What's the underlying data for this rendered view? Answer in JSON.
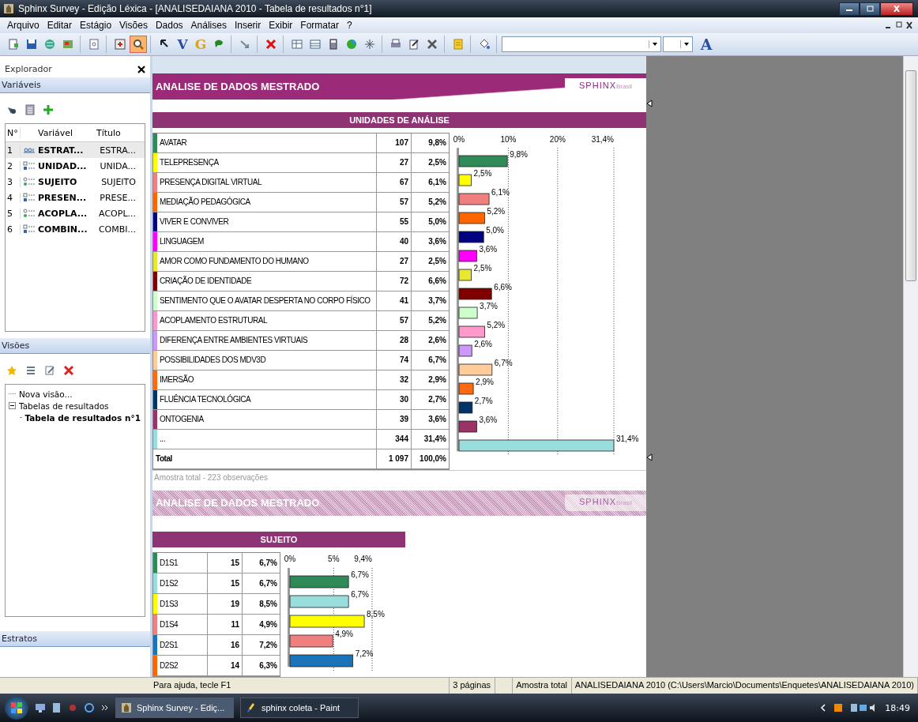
{
  "window": {
    "title": "Sphinx Survey - Edição Léxica - [ANALISEDAIANA 2010 - Tabela de resultados n°1]"
  },
  "menu": [
    {
      "label": "Arquivo"
    },
    {
      "label": "Editar"
    },
    {
      "label": "Estágio"
    },
    {
      "label": "Visões"
    },
    {
      "label": "Dados"
    },
    {
      "label": "Análises"
    },
    {
      "label": "Inserir"
    },
    {
      "label": "Exibir"
    },
    {
      "label": "Formatar"
    },
    {
      "label": "?"
    }
  ],
  "toolbar": {
    "groups": [
      [
        {
          "active": false
        },
        {
          "active": false
        },
        {
          "active": false
        },
        {
          "active": false
        }
      ],
      [
        {
          "active": false
        }
      ],
      [
        {
          "active": false
        },
        {
          "active": true
        }
      ],
      [
        {
          "active": false
        },
        {
          "glyph": "V",
          "active": false
        },
        {
          "glyph": "G",
          "active": false
        },
        {
          "active": false
        }
      ],
      [
        {
          "active": false
        }
      ],
      [
        {
          "active": false
        }
      ],
      [
        {
          "active": false
        },
        {
          "active": false
        },
        {
          "active": false
        },
        {
          "active": false
        },
        {
          "active": false
        }
      ],
      [
        {
          "active": false
        },
        {
          "active": false
        },
        {
          "active": false
        }
      ],
      [
        {
          "active": false
        }
      ],
      [
        {
          "active": false
        }
      ]
    ],
    "end_glyph": "A"
  },
  "explorer": {
    "title": "Explorador",
    "variables": {
      "title": "Variáveis",
      "columns": [
        "N°",
        "Variável",
        "Título"
      ],
      "rows": [
        {
          "number": "1",
          "kind": "text",
          "name": "ESTRAT...",
          "title": "ESTRA...",
          "selected": true
        },
        {
          "number": "2",
          "kind": "closed",
          "name": "UNIDAD...",
          "title": "UNIDA...",
          "selected": false
        },
        {
          "number": "3",
          "kind": "scale",
          "name": "SUJEITO",
          "title": "SUJEITO",
          "selected": false
        },
        {
          "number": "4",
          "kind": "closed",
          "name": "PRESEN...",
          "title": "PRESE...",
          "selected": false
        },
        {
          "number": "5",
          "kind": "scale",
          "name": "ACOPLA...",
          "title": "ACOPL...",
          "selected": false
        },
        {
          "number": "6",
          "kind": "closed",
          "name": "COMBIN...",
          "title": "COMBI...",
          "selected": false
        }
      ]
    },
    "views": {
      "title": "Visões",
      "tree": [
        {
          "label": "Nova visão...",
          "selected": false
        },
        {
          "label": "Tabelas de resultados",
          "expanded": true,
          "selected": false,
          "children": [
            {
              "label": "Tabela de resultados n°1",
              "selected": true
            }
          ]
        }
      ]
    },
    "strata": {
      "title": "Estratos"
    }
  },
  "document": {
    "pages": [
      {
        "header": "ANALISE DE DADOS MESTRADO",
        "logo": "SPHINX",
        "logo_suffix": "Brasil",
        "faded": false,
        "table": {
          "title": "UNIDADES DE ANÁLISE",
          "rows": [
            {
              "label": "AVATAR",
              "count": "107",
              "percent": "9,8%",
              "color": "#2e8b57"
            },
            {
              "label": "TELEPRESENÇA",
              "count": "27",
              "percent": "2,5%",
              "color": "#ffff00"
            },
            {
              "label": "PRESENÇA DIGITAL VIRTUAL",
              "count": "67",
              "percent": "6,1%",
              "color": "#f08080"
            },
            {
              "label": "MEDIAÇÃO PEDAGÓGICA",
              "count": "57",
              "percent": "5,2%",
              "color": "#ff6600"
            },
            {
              "label": "VIVER E CONVIVER",
              "count": "55",
              "percent": "5,0%",
              "color": "#000080"
            },
            {
              "label": "LINGUAGEM",
              "count": "40",
              "percent": "3,6%",
              "color": "#ff00ff"
            },
            {
              "label": "AMOR COMO FUNDAMENTO DO HUMANO",
              "count": "27",
              "percent": "2,5%",
              "color": "#e8e830"
            },
            {
              "label": "CRIAÇÃO DE IDENTIDADE",
              "count": "72",
              "percent": "6,6%",
              "color": "#800000"
            },
            {
              "label": "SENTIMENTO QUE O AVATAR DESPERTA NO CORPO FÍSICO",
              "count": "41",
              "percent": "3,7%",
              "color": "#ccffcc"
            },
            {
              "label": "ACOPLAMENTO ESTRUTURAL",
              "count": "57",
              "percent": "5,2%",
              "color": "#ff99cc"
            },
            {
              "label": "DIFERENÇA ENTRE AMBIENTES VIRTUAIS",
              "count": "28",
              "percent": "2,6%",
              "color": "#cc99ff"
            },
            {
              "label": "POSSIBILIDADES DOS MDV3D",
              "count": "74",
              "percent": "6,7%",
              "color": "#ffcc99"
            },
            {
              "label": "IMERSÃO",
              "count": "32",
              "percent": "2,9%",
              "color": "#ff6a10"
            },
            {
              "label": "FLUÊNCIA TECNOLÓGICA",
              "count": "30",
              "percent": "2,7%",
              "color": "#003366"
            },
            {
              "label": "ONTOGENIA",
              "count": "39",
              "percent": "3,6%",
              "color": "#993366"
            },
            {
              "label": "...",
              "count": "344",
              "percent": "31,4%",
              "color": "#99dddd"
            }
          ],
          "total": {
            "label": "Total",
            "count": "1 097",
            "percent": "100,0%"
          },
          "chart_data": {
            "type": "bar",
            "orientation": "horizontal",
            "series": [
              {
                "values": [
                  9.8,
                  2.5,
                  6.1,
                  5.2,
                  5.0,
                  3.6,
                  2.5,
                  6.6,
                  3.7,
                  5.2,
                  2.6,
                  6.7,
                  2.9,
                  2.7,
                  3.6,
                  31.4
                ]
              }
            ],
            "xlim": [
              0,
              31.4
            ],
            "xticks": [
              {
                "value": 0,
                "label": "0%"
              },
              {
                "value": 10,
                "label": "10%"
              },
              {
                "value": 20,
                "label": "20%"
              },
              {
                "value": 31.4,
                "label": "31,4%"
              }
            ],
            "value_labels": [
              "9,8%",
              "2,5%",
              "6,1%",
              "5,2%",
              "5,0%",
              "3,6%",
              "2,5%",
              "6,6%",
              "3,7%",
              "5,2%",
              "2,6%",
              "6,7%",
              "2,9%",
              "2,7%",
              "3,6%",
              "31,4%"
            ]
          }
        },
        "note": "Amostra total - 223 observações"
      },
      {
        "header": "ANALISE DE DADOS MESTRADO",
        "logo": "SPHINX",
        "logo_suffix": "Brasil",
        "faded": true,
        "table": {
          "title": "SUJEITO",
          "rows": [
            {
              "label": "D1S1",
              "count": "15",
              "percent": "6,7%",
              "color": "#2e8b57"
            },
            {
              "label": "D1S2",
              "count": "15",
              "percent": "6,7%",
              "color": "#99dddd"
            },
            {
              "label": "D1S3",
              "count": "19",
              "percent": "8,5%",
              "color": "#ffff00"
            },
            {
              "label": "D1S4",
              "count": "11",
              "percent": "4,9%",
              "color": "#f08080"
            },
            {
              "label": "D2S1",
              "count": "16",
              "percent": "7,2%",
              "color": "#1a72b8"
            },
            {
              "label": "D2S2",
              "count": "14",
              "percent": "6,3%",
              "color": "#ff6600"
            }
          ],
          "chart_data": {
            "type": "bar",
            "orientation": "horizontal",
            "series": [
              {
                "values": [
                  6.7,
                  6.7,
                  8.5,
                  4.9,
                  7.2
                ]
              }
            ],
            "xlim": [
              0,
              9.4
            ],
            "xticks": [
              {
                "value": 0,
                "label": "0%"
              },
              {
                "value": 5,
                "label": "5%"
              },
              {
                "value": 9.4,
                "label": "9,4%"
              }
            ],
            "value_labels": [
              "6,7%",
              "6,7%",
              "8,5%",
              "4,9%",
              "7,2%"
            ]
          }
        }
      }
    ]
  },
  "status_bar": {
    "help": "Para ajuda, tecle F1",
    "pages": "3 páginas",
    "sample": "Amostra total",
    "file": "ANALISEDAIANA 2010 (C:\\Users\\Marcio\\Documents\\Enquetes\\ANALISEDAIANA 2010)"
  },
  "taskbar": {
    "tasks": [
      {
        "label": "Sphinx Survey - Ediç...",
        "active": true
      },
      {
        "label": "sphinx coleta - Paint",
        "active": false
      }
    ],
    "clock": "18:49"
  }
}
